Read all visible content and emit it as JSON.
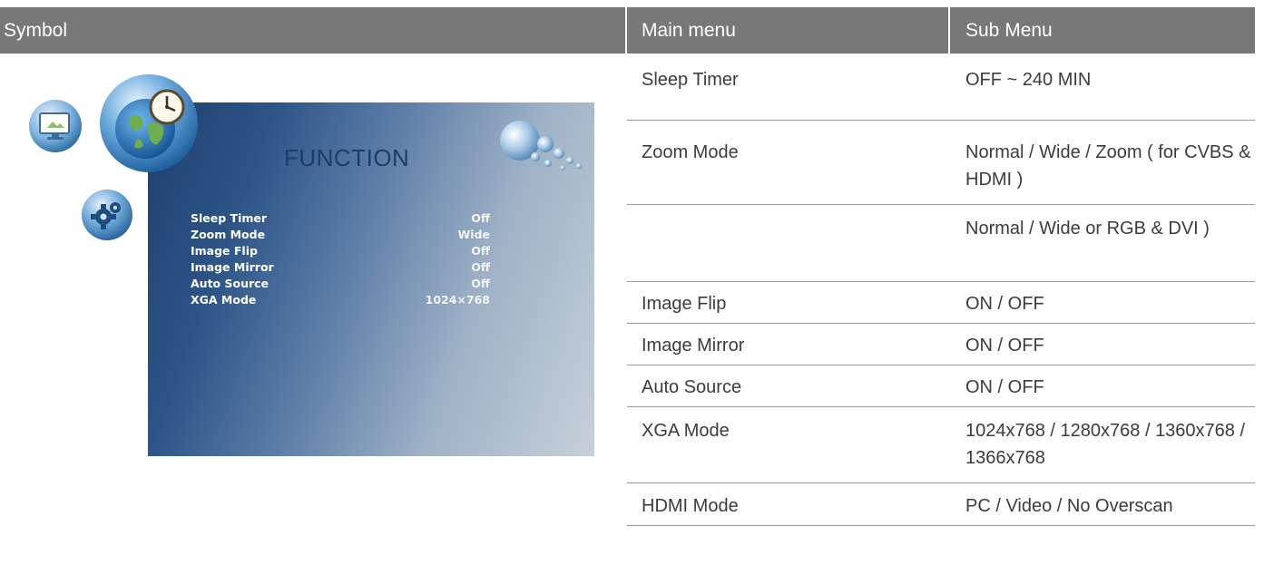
{
  "header": {
    "symbol": "Symbol",
    "main_menu": "Main menu",
    "sub_menu": "Sub Menu"
  },
  "rows": [
    {
      "main": "Sleep Timer",
      "sub": "OFF ~ 240 MIN"
    },
    {
      "main": "Zoom Mode",
      "sub": "Normal / Wide / Zoom ( for CVBS & HDMI )"
    },
    {
      "main": "",
      "sub": "Normal / Wide or RGB & DVI )"
    },
    {
      "main": "Image Flip",
      "sub": "ON / OFF"
    },
    {
      "main": "Image Mirror",
      "sub": "ON / OFF"
    },
    {
      "main": "Auto Source",
      "sub": "ON / OFF"
    },
    {
      "main": "XGA Mode",
      "sub": "1024x768 / 1280x768 / 1360x768 / 1366x768"
    },
    {
      "main": "HDMI Mode",
      "sub": "PC / Video / No Overscan"
    }
  ],
  "osd": {
    "title": "FUNCTION",
    "items": [
      {
        "label": "Sleep Timer",
        "value": "Off"
      },
      {
        "label": "Zoom Mode",
        "value": "Wide"
      },
      {
        "label": "Image Flip",
        "value": "Off"
      },
      {
        "label": "Image Mirror",
        "value": "Off"
      },
      {
        "label": "Auto Source",
        "value": "Off"
      },
      {
        "label": "XGA Mode",
        "value": "1024×768"
      }
    ]
  },
  "icons": [
    "display-icon",
    "globe-clock-icon",
    "gear-icon",
    "bubbles-icon"
  ],
  "colors": {
    "header_bg": "#787878",
    "header_text": "#ffffff",
    "osd_dark": "#1f3f6d",
    "osd_light": "#c7d0da"
  }
}
